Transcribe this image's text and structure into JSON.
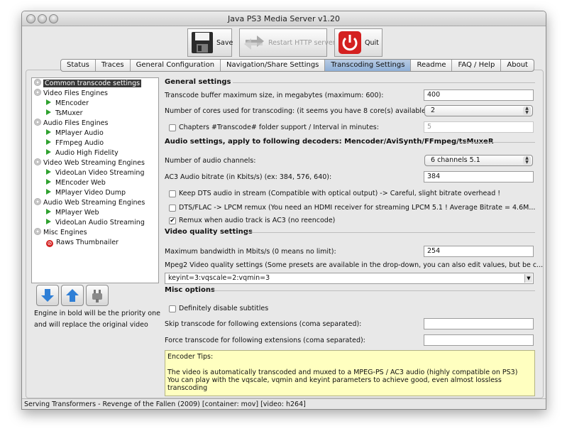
{
  "window": {
    "title": "Java PS3 Media Server v1.20"
  },
  "toolbar": {
    "save_label": "Save",
    "restart_label": "Restart HTTP server",
    "quit_label": "Quit"
  },
  "tabs": [
    {
      "label": "Status"
    },
    {
      "label": "Traces"
    },
    {
      "label": "General Configuration"
    },
    {
      "label": "Navigation/Share Settings"
    },
    {
      "label": "Transcoding Settings",
      "active": true
    },
    {
      "label": "Readme"
    },
    {
      "label": "FAQ / Help"
    },
    {
      "label": "About"
    }
  ],
  "tree": {
    "items": [
      {
        "label": "Common transcode settings",
        "icon": "gear-icon",
        "level": 0,
        "selected": true
      },
      {
        "label": "Video Files Engines",
        "icon": "gear-icon",
        "level": 0
      },
      {
        "label": "MEncoder",
        "icon": "play-icon",
        "level": 1
      },
      {
        "label": "TsMuxer",
        "icon": "play-icon",
        "level": 1
      },
      {
        "label": "Audio Files Engines",
        "icon": "gear-icon",
        "level": 0
      },
      {
        "label": "MPlayer Audio",
        "icon": "play-icon",
        "level": 1
      },
      {
        "label": "FFmpeg Audio",
        "icon": "play-icon",
        "level": 1
      },
      {
        "label": "Audio High Fidelity",
        "icon": "play-icon",
        "level": 1
      },
      {
        "label": "Video Web Streaming Engines",
        "icon": "gear-icon",
        "level": 0
      },
      {
        "label": "VideoLan Video Streaming",
        "icon": "play-icon",
        "level": 1
      },
      {
        "label": "MEncoder Web",
        "icon": "play-icon",
        "level": 1
      },
      {
        "label": "MPlayer Video Dump",
        "icon": "play-icon",
        "level": 1
      },
      {
        "label": "Audio Web Streaming Engines",
        "icon": "gear-icon",
        "level": 0
      },
      {
        "label": "MPlayer Web",
        "icon": "play-icon",
        "level": 1
      },
      {
        "label": "VideoLan Audio Streaming",
        "icon": "play-icon",
        "level": 1
      },
      {
        "label": "Misc Engines",
        "icon": "gear-icon",
        "level": 0
      },
      {
        "label": "Raws Thumbnailer",
        "icon": "disabled-icon",
        "level": 1
      }
    ]
  },
  "engine_note": {
    "line1": "Engine in bold will be the priority one",
    "line2": "and will replace the original video"
  },
  "general": {
    "heading": "General settings",
    "buffer_label": "Transcode buffer maximum size, in megabytes (maximum: 600):",
    "buffer_value": "400",
    "cores_label": "Number of cores used for transcoding: (it seems you have 8 core(s) available)",
    "cores_value": "2",
    "chapters_label": "Chapters #Transcode# folder support / Interval in minutes:",
    "chapters_checked": false,
    "chapters_value": "5"
  },
  "audio": {
    "heading": "Audio settings, apply to following decoders: Mencoder/AviSynth/FFmpeg/tsMuxeR",
    "channels_label": "Number of audio channels:",
    "channels_value": "6 channels 5.1",
    "ac3_label": "AC3 Audio bitrate (in Kbits/s) (ex: 384, 576, 640):",
    "ac3_value": "384",
    "dts_label": "Keep DTS audio in stream (Compatible with optical output) -> Careful, slight bitrate overhead !",
    "dts_checked": false,
    "lpcm_label": "DTS/FLAC -> LPCM remux (You need an HDMI receiver for streaming LPCM 5.1 ! Average Bitrate = 4.6M...",
    "lpcm_checked": false,
    "remux_label": "Remux when audio track is AC3 (no reencode)",
    "remux_checked": true
  },
  "video": {
    "heading": "Video quality settings",
    "bandwidth_label": "Maximum bandwidth in Mbits/s (0 means no limit):",
    "bandwidth_value": "254",
    "mpeg2_label": "Mpeg2 Video quality settings (Some presets are available in the drop-down, you can also edit values, but be c...",
    "mpeg2_value": "keyint=3:vqscale=2:vqmin=3"
  },
  "misc": {
    "heading": "Misc options",
    "subs_label": "Definitely disable subtitles",
    "subs_checked": false,
    "skip_label": "Skip transcode for following extensions (coma separated):",
    "skip_value": "",
    "force_label": "Force transcode for following extensions (coma separated):",
    "force_value": ""
  },
  "tips": {
    "line1": "Encoder Tips:",
    "line2": "",
    "line3": "The video is automatically transcoded and muxed to a MPEG-PS / AC3 audio (highly compatible on PS3)",
    "line4": "You can play with the vqscale, vqmin and keyint parameters to achieve good, even almost lossless transcoding"
  },
  "status_bar": {
    "text": "Serving Transformers - Revenge of the Fallen (2009) [container: mov] [video: h264]"
  },
  "colors": {
    "tips_bg": "#ffffc0",
    "tab_active": "#9fbadf",
    "quit_red": "#d42020",
    "play_green": "#2ea12e"
  }
}
